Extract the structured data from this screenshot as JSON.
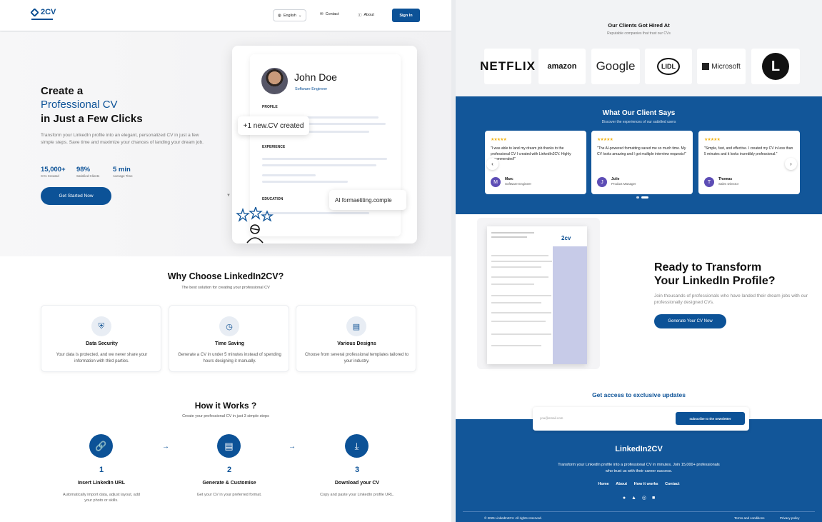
{
  "nav": {
    "logo": "2CV",
    "language": "English",
    "contact": "Contact",
    "about": "About",
    "sign_in": "Sign In"
  },
  "hero": {
    "line1": "Create a",
    "line2": "Professional CV",
    "line3": "in Just a Few Clicks",
    "description": "Transform your LinkedIn profile into an elegant, personalized CV in just a few simple steps. Save time and maximize your chances of landing your dream job.",
    "stats": [
      {
        "value": "15,000+",
        "label": "CVs Created"
      },
      {
        "value": "98%",
        "label": "Satisfied Clients"
      },
      {
        "value": "5 min",
        "label": "Average Time"
      }
    ],
    "cta": "Get Started Now",
    "preview": {
      "name": "John Doe",
      "role": "Software Engineer",
      "profile": "PROFILE",
      "experience": "EXPERIENCE",
      "education": "EDUCATION",
      "bubble_created": "+1 new.CV created",
      "bubble_ai": "AI formaetiting.comple"
    }
  },
  "why": {
    "title": "Why Choose LinkedIn2CV?",
    "subtitle": "The best solution for creating your professional CV",
    "features": [
      {
        "icon": "shield-icon",
        "title": "Data Security",
        "desc": "Your data is protected, and we never share your information with third parties."
      },
      {
        "icon": "clock-icon",
        "title": "Time Saving",
        "desc": "Generate a CV in under 5 minutes instead of spending hours designing it manually."
      },
      {
        "icon": "document-icon",
        "title": "Various Designs",
        "desc": "Choose from several professional templates tailored to your industry."
      }
    ]
  },
  "how": {
    "title": "How it Works ?",
    "subtitle": "Create your professional CV in just 3 simple steps",
    "steps": [
      {
        "n": "1",
        "title": "Insert LinkedIn URL",
        "desc": "Automatically import data, adjust layout, add your photo or skills."
      },
      {
        "n": "2",
        "title": "Generate & Customise",
        "desc": "Get your CV in your preferred format."
      },
      {
        "n": "3",
        "title": "Download your CV",
        "desc": "Copy and paste your LinkedIn profile URL."
      }
    ]
  },
  "clients": {
    "title": "Our Clients Got Hired At",
    "subtitle": "Reputable companies that trust our CVs",
    "logos": [
      "NETFLIX",
      "amazon",
      "Google",
      "LIDL",
      "Microsoft",
      "L"
    ]
  },
  "testimonials": {
    "title": "What Our Client Says",
    "subtitle": "Discover the experiences of our satisfied users",
    "stars": "★★★★★",
    "items": [
      {
        "quote": "\"I was able to land my dream job thanks to the professional CV I created with LinkedIn2CV. Highly recommended!\"",
        "initial": "M",
        "name": "Marc",
        "role": "Software Engineer"
      },
      {
        "quote": "\"The AI-powered formatting saved me so much time. My CV looks amazing and I got multiple interview requests!\"",
        "initial": "J",
        "name": "Julie",
        "role": "Product Manager"
      },
      {
        "quote": "\"Simple, fast, and effective. I created my CV in less than 5 minutes and it looks incredibly professional.\"",
        "initial": "T",
        "name": "Thomas",
        "role": "Sales Director"
      }
    ]
  },
  "cta": {
    "title_line1": "Ready to Transform",
    "title_line2": "Your LinkedIn Profile?",
    "desc": "Join thousands of professionals who have landed their dream jobs with our professionally designed CVs.",
    "button": "Generate Your CV Now",
    "paper_logo": "2cv"
  },
  "updates": {
    "title": "Get access to exclusive updates",
    "placeholder": "you@email.com",
    "button": "subscribe to the newsletter"
  },
  "footer": {
    "title": "LinkedIn2CV",
    "desc": "Transform your LinkedIn profile into a professional CV in minutes. Join 15,000+ professionals who trust us with their career success.",
    "links": [
      "Home",
      "About",
      "How it works",
      "Contact"
    ],
    "copyright": "© 2025 LinkedIn2CV. All rights reserved.",
    "terms": "Terms and conditions",
    "privacy": "Privacy policy"
  },
  "colors": {
    "primary": "#0c5297",
    "footer": "#125699",
    "star": "#f2b61d"
  }
}
